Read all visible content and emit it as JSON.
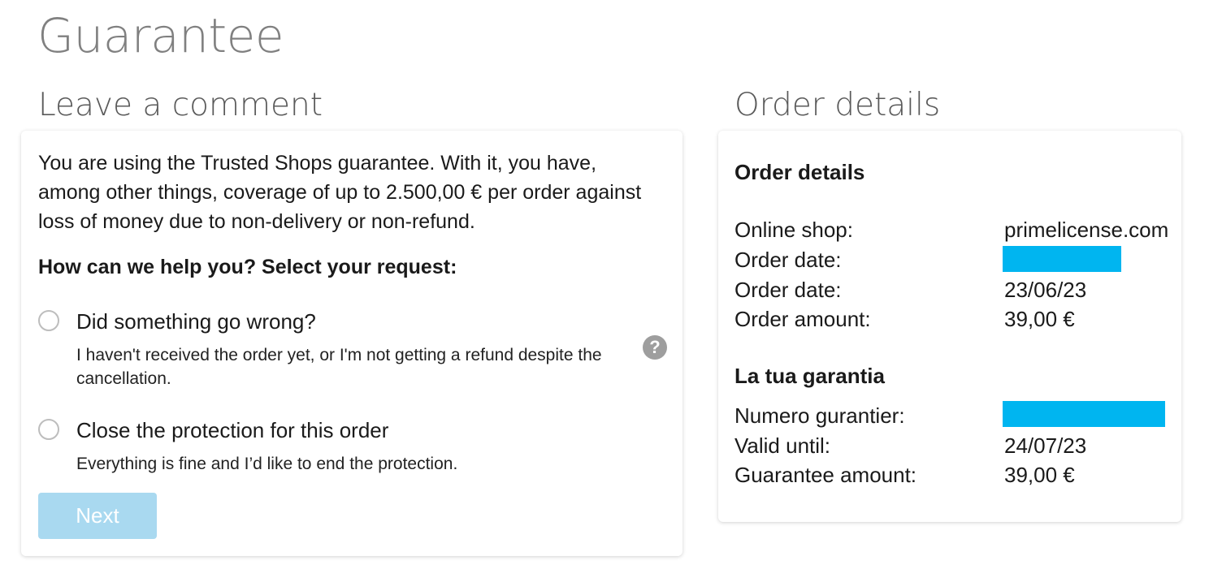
{
  "page": {
    "title": "Guarantee"
  },
  "comment_section": {
    "title": "Leave a comment",
    "intro": "You are using the Trusted Shops guarantee. With it, you have, among other things, coverage of up to 2.500,00 € per order against loss of money due to non-delivery or non-refund.",
    "prompt": "How can we help you? Select your request:",
    "options": [
      {
        "title": "Did something go wrong?",
        "description": "I haven't received the order yet, or I'm not getting a refund despite the cancellation.",
        "selected": false
      },
      {
        "title": "Close the protection for this order",
        "description": "Everything is fine and I’d like to end the protection.",
        "selected": false
      }
    ],
    "help_icon_glyph": "?",
    "next_label": "Next",
    "next_enabled": false
  },
  "order_section": {
    "title": "Order details",
    "details_heading": "Order details",
    "details": [
      {
        "label": "Online shop:",
        "value": "primelicense.com",
        "redacted": false
      },
      {
        "label": "Order date:",
        "value": "",
        "redacted": true
      },
      {
        "label": "Order date:",
        "value": "23/06/23",
        "redacted": false
      },
      {
        "label": "Order amount:",
        "value": "39,00 €",
        "redacted": false
      }
    ],
    "guarantee_heading": "La tua garantia",
    "guarantee": [
      {
        "label": "Numero gurantier:",
        "value": "",
        "redacted": true
      },
      {
        "label": "Valid until:",
        "value": "24/07/23",
        "redacted": false
      },
      {
        "label": "Guarantee amount:",
        "value": "39,00 €",
        "redacted": false
      }
    ]
  },
  "colors": {
    "title_gray": "#808080",
    "button_disabled": "#a9d9f0",
    "redaction": "#00b5f0",
    "help_icon": "#9e9e9e"
  },
  "icons": {
    "help": "question-circle-icon",
    "radio": "radio-unchecked-icon"
  }
}
